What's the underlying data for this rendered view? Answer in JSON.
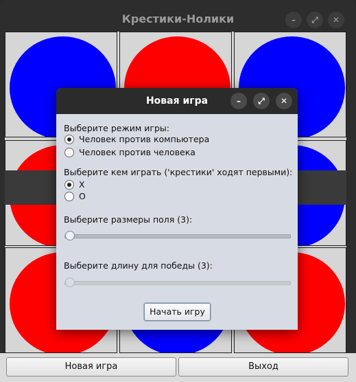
{
  "main_window": {
    "title": "Крестики-Нолики",
    "controls": {
      "minimize": "–",
      "maximize": "⤢",
      "close": "✕"
    }
  },
  "board": {
    "cells": [
      {
        "row": 0,
        "col": 0,
        "mark": "blue"
      },
      {
        "row": 0,
        "col": 1,
        "mark": "red"
      },
      {
        "row": 0,
        "col": 2,
        "mark": "blue"
      },
      {
        "row": 1,
        "col": 0,
        "mark": "red"
      },
      {
        "row": 1,
        "col": 1,
        "mark": "red"
      },
      {
        "row": 1,
        "col": 2,
        "mark": "blue"
      },
      {
        "row": 2,
        "col": 0,
        "mark": "red"
      },
      {
        "row": 2,
        "col": 1,
        "mark": "blue"
      },
      {
        "row": 2,
        "col": 2,
        "mark": "red"
      }
    ],
    "colors": {
      "blue": "#0000ff",
      "red": "#ff0000"
    }
  },
  "bottom_bar": {
    "new_game_label": "Новая игра",
    "exit_label": "Выход"
  },
  "dialog": {
    "title": "Новая игра",
    "controls": {
      "minimize": "–",
      "maximize": "⤢",
      "close": "✕"
    },
    "mode_label": "Выберите режим игры:",
    "mode_options": [
      "Человек против компьютера",
      "Человек против человека"
    ],
    "mode_selected": 0,
    "side_label": "Выберите кем играть ('крестики' ходят первыми):",
    "side_options": [
      "X",
      "O"
    ],
    "side_selected": 0,
    "size_label": "Выберите размеры поля (3):",
    "size_value": 3,
    "win_label": "Выберите длину для победы (3):",
    "win_value": 3,
    "start_label": "Начать игру"
  }
}
